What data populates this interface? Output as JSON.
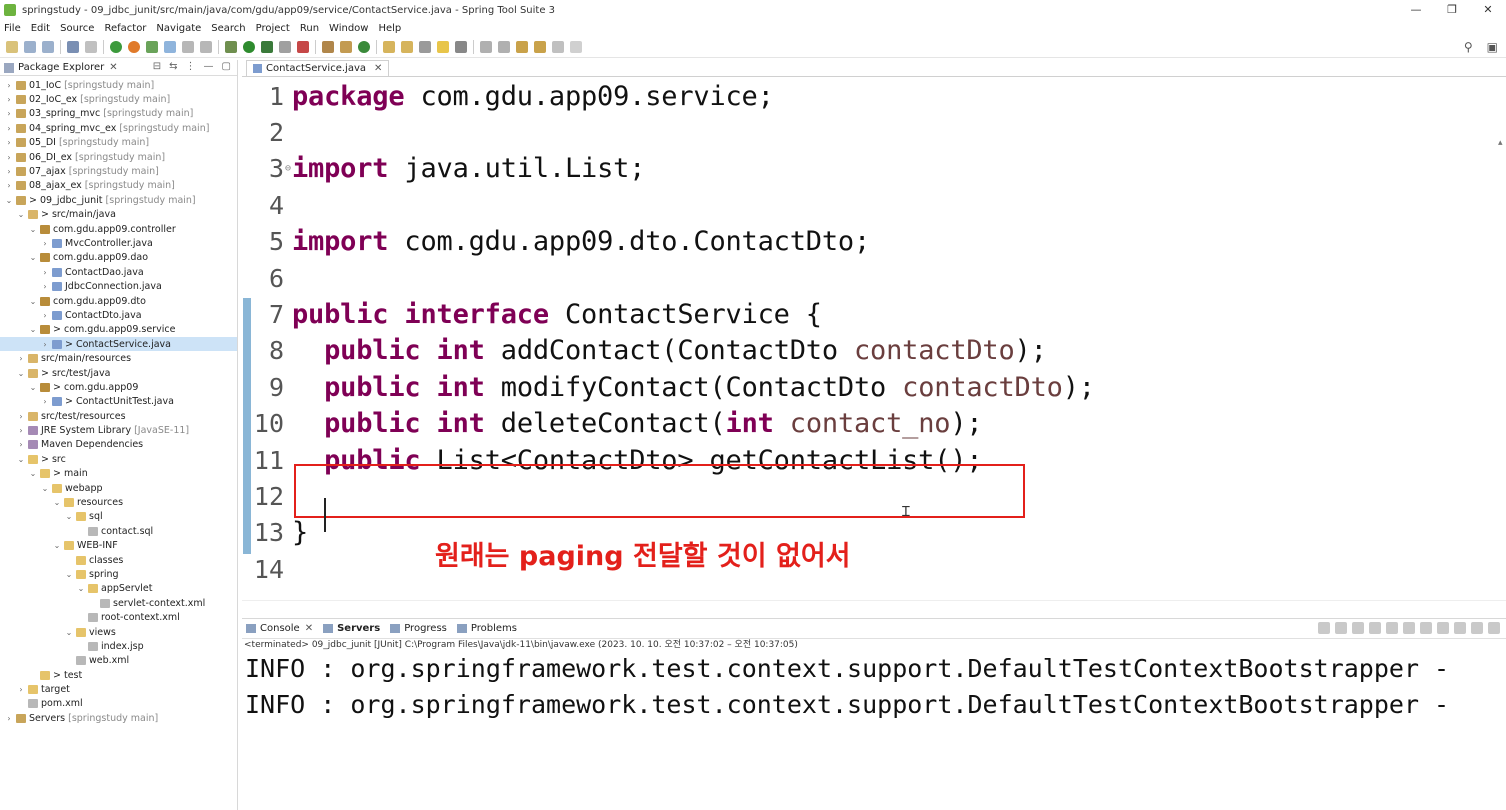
{
  "window": {
    "title": "springstudy - 09_jdbc_junit/src/main/java/com/gdu/app09/service/ContactService.java - Spring Tool Suite 3",
    "minimize": "—",
    "restore": "❐",
    "close": "✕"
  },
  "menu": [
    "File",
    "Edit",
    "Source",
    "Refactor",
    "Navigate",
    "Search",
    "Project",
    "Run",
    "Window",
    "Help"
  ],
  "explorer": {
    "title": "Package Explorer",
    "close": "✕",
    "tree": [
      {
        "indent": 0,
        "tw": "›",
        "icon": "project",
        "label": "01_IoC",
        "sub": "[springstudy main]"
      },
      {
        "indent": 0,
        "tw": "›",
        "icon": "project",
        "label": "02_IoC_ex",
        "sub": "[springstudy main]"
      },
      {
        "indent": 0,
        "tw": "›",
        "icon": "project",
        "label": "03_spring_mvc",
        "sub": "[springstudy main]"
      },
      {
        "indent": 0,
        "tw": "›",
        "icon": "project",
        "label": "04_spring_mvc_ex",
        "sub": "[springstudy main]"
      },
      {
        "indent": 0,
        "tw": "›",
        "icon": "project",
        "label": "05_DI",
        "sub": "[springstudy main]"
      },
      {
        "indent": 0,
        "tw": "›",
        "icon": "project",
        "label": "06_DI_ex",
        "sub": "[springstudy main]"
      },
      {
        "indent": 0,
        "tw": "›",
        "icon": "project",
        "label": "07_ajax",
        "sub": "[springstudy main]"
      },
      {
        "indent": 0,
        "tw": "›",
        "icon": "project",
        "label": "08_ajax_ex",
        "sub": "[springstudy main]"
      },
      {
        "indent": 0,
        "tw": "⌄",
        "icon": "project",
        "label": "> 09_jdbc_junit",
        "sub": "[springstudy main]"
      },
      {
        "indent": 1,
        "tw": "⌄",
        "icon": "src",
        "label": "> src/main/java",
        "sub": ""
      },
      {
        "indent": 2,
        "tw": "⌄",
        "icon": "pkg",
        "label": "com.gdu.app09.controller",
        "sub": ""
      },
      {
        "indent": 3,
        "tw": "›",
        "icon": "java",
        "label": "MvcController.java",
        "sub": ""
      },
      {
        "indent": 2,
        "tw": "⌄",
        "icon": "pkg",
        "label": "com.gdu.app09.dao",
        "sub": ""
      },
      {
        "indent": 3,
        "tw": "›",
        "icon": "java",
        "label": "ContactDao.java",
        "sub": ""
      },
      {
        "indent": 3,
        "tw": "›",
        "icon": "java",
        "label": "JdbcConnection.java",
        "sub": ""
      },
      {
        "indent": 2,
        "tw": "⌄",
        "icon": "pkg",
        "label": "com.gdu.app09.dto",
        "sub": ""
      },
      {
        "indent": 3,
        "tw": "›",
        "icon": "java",
        "label": "ContactDto.java",
        "sub": ""
      },
      {
        "indent": 2,
        "tw": "⌄",
        "icon": "pkg",
        "label": "> com.gdu.app09.service",
        "sub": ""
      },
      {
        "indent": 3,
        "tw": "›",
        "icon": "java",
        "label": "> ContactService.java",
        "sub": "",
        "selected": true
      },
      {
        "indent": 1,
        "tw": "›",
        "icon": "src",
        "label": "src/main/resources",
        "sub": ""
      },
      {
        "indent": 1,
        "tw": "⌄",
        "icon": "src",
        "label": "> src/test/java",
        "sub": ""
      },
      {
        "indent": 2,
        "tw": "⌄",
        "icon": "pkg",
        "label": "> com.gdu.app09",
        "sub": ""
      },
      {
        "indent": 3,
        "tw": "›",
        "icon": "java",
        "label": "> ContactUnitTest.java",
        "sub": ""
      },
      {
        "indent": 1,
        "tw": "›",
        "icon": "src",
        "label": "src/test/resources",
        "sub": ""
      },
      {
        "indent": 1,
        "tw": "›",
        "icon": "lib",
        "label": "JRE System Library",
        "sub": "[JavaSE-11]"
      },
      {
        "indent": 1,
        "tw": "›",
        "icon": "lib",
        "label": "Maven Dependencies",
        "sub": ""
      },
      {
        "indent": 1,
        "tw": "⌄",
        "icon": "folder",
        "label": "> src",
        "sub": ""
      },
      {
        "indent": 2,
        "tw": "⌄",
        "icon": "folder",
        "label": "> main",
        "sub": ""
      },
      {
        "indent": 3,
        "tw": "⌄",
        "icon": "folder",
        "label": "webapp",
        "sub": ""
      },
      {
        "indent": 4,
        "tw": "⌄",
        "icon": "folder",
        "label": "resources",
        "sub": ""
      },
      {
        "indent": 5,
        "tw": "⌄",
        "icon": "folder",
        "label": "sql",
        "sub": ""
      },
      {
        "indent": 6,
        "tw": "",
        "icon": "file",
        "label": "contact.sql",
        "sub": ""
      },
      {
        "indent": 4,
        "tw": "⌄",
        "icon": "folder",
        "label": "WEB-INF",
        "sub": ""
      },
      {
        "indent": 5,
        "tw": "",
        "icon": "folder",
        "label": "classes",
        "sub": ""
      },
      {
        "indent": 5,
        "tw": "⌄",
        "icon": "folder",
        "label": "spring",
        "sub": ""
      },
      {
        "indent": 6,
        "tw": "⌄",
        "icon": "folder",
        "label": "appServlet",
        "sub": ""
      },
      {
        "indent": 7,
        "tw": "",
        "icon": "file",
        "label": "servlet-context.xml",
        "sub": ""
      },
      {
        "indent": 6,
        "tw": "",
        "icon": "file",
        "label": "root-context.xml",
        "sub": ""
      },
      {
        "indent": 5,
        "tw": "⌄",
        "icon": "folder",
        "label": "views",
        "sub": ""
      },
      {
        "indent": 6,
        "tw": "",
        "icon": "file",
        "label": "index.jsp",
        "sub": ""
      },
      {
        "indent": 5,
        "tw": "",
        "icon": "file",
        "label": "web.xml",
        "sub": ""
      },
      {
        "indent": 2,
        "tw": "",
        "icon": "folder",
        "label": "> test",
        "sub": ""
      },
      {
        "indent": 1,
        "tw": "›",
        "icon": "folder",
        "label": "target",
        "sub": ""
      },
      {
        "indent": 1,
        "tw": "",
        "icon": "file",
        "label": "pom.xml",
        "sub": ""
      },
      {
        "indent": 0,
        "tw": "›",
        "icon": "project",
        "label": "Servers",
        "sub": "[springstudy main]"
      }
    ]
  },
  "editor": {
    "tab_label": "ContactService.java",
    "tab_close": "✕",
    "lines": [
      {
        "n": "1",
        "fold": "",
        "segs": [
          {
            "t": "package",
            "c": "kw"
          },
          {
            "t": " com.gdu.app09.service;",
            "c": ""
          }
        ]
      },
      {
        "n": "2",
        "fold": "",
        "segs": []
      },
      {
        "n": "3",
        "fold": "⊖",
        "segs": [
          {
            "t": "import",
            "c": "kw"
          },
          {
            "t": " java.util.List;",
            "c": ""
          }
        ]
      },
      {
        "n": "4",
        "fold": "",
        "segs": []
      },
      {
        "n": "5",
        "fold": "",
        "segs": [
          {
            "t": "import",
            "c": "kw"
          },
          {
            "t": " com.gdu.app09.dto.ContactDto;",
            "c": ""
          }
        ]
      },
      {
        "n": "6",
        "fold": "",
        "segs": []
      },
      {
        "n": "7",
        "fold": "",
        "segs": [
          {
            "t": "public",
            "c": "kw"
          },
          {
            "t": " ",
            "c": ""
          },
          {
            "t": "interface",
            "c": "kw"
          },
          {
            "t": " ContactService {",
            "c": ""
          }
        ]
      },
      {
        "n": "8",
        "fold": "",
        "segs": [
          {
            "t": "  ",
            "c": ""
          },
          {
            "t": "public",
            "c": "kw"
          },
          {
            "t": " ",
            "c": ""
          },
          {
            "t": "int",
            "c": "kw"
          },
          {
            "t": " addContact(ContactDto ",
            "c": ""
          },
          {
            "t": "contactDto",
            "c": "param"
          },
          {
            "t": ");",
            "c": ""
          }
        ]
      },
      {
        "n": "9",
        "fold": "",
        "segs": [
          {
            "t": "  ",
            "c": ""
          },
          {
            "t": "public",
            "c": "kw"
          },
          {
            "t": " ",
            "c": ""
          },
          {
            "t": "int",
            "c": "kw"
          },
          {
            "t": " modifyContact(ContactDto ",
            "c": ""
          },
          {
            "t": "contactDto",
            "c": "param"
          },
          {
            "t": ");",
            "c": ""
          }
        ]
      },
      {
        "n": "10",
        "fold": "",
        "segs": [
          {
            "t": "  ",
            "c": ""
          },
          {
            "t": "public",
            "c": "kw"
          },
          {
            "t": " ",
            "c": ""
          },
          {
            "t": "int",
            "c": "kw"
          },
          {
            "t": " deleteContact(",
            "c": ""
          },
          {
            "t": "int",
            "c": "kw"
          },
          {
            "t": " ",
            "c": ""
          },
          {
            "t": "contact_no",
            "c": "param"
          },
          {
            "t": ");",
            "c": ""
          }
        ]
      },
      {
        "n": "11",
        "fold": "",
        "segs": [
          {
            "t": "  ",
            "c": ""
          },
          {
            "t": "public",
            "c": "kw"
          },
          {
            "t": " List<ContactDto> getContactList();",
            "c": ""
          }
        ]
      },
      {
        "n": "12",
        "fold": "",
        "segs": []
      },
      {
        "n": "13",
        "fold": "",
        "segs": [
          {
            "t": "}",
            "c": ""
          }
        ]
      },
      {
        "n": "14",
        "fold": "",
        "segs": []
      }
    ],
    "annotation": "원래는 paging 전달할 것이 없어서"
  },
  "bottom": {
    "tabs": [
      {
        "label": "Console",
        "active": false,
        "close": "✕"
      },
      {
        "label": "Servers",
        "active": true,
        "close": ""
      },
      {
        "label": "Progress",
        "active": false,
        "close": ""
      },
      {
        "label": "Problems",
        "active": false,
        "close": ""
      }
    ],
    "console_header": "<terminated> 09_jdbc_junit [JUnit] C:\\Program Files\\Java\\jdk-11\\bin\\javaw.exe  (2023. 10. 10. 오전 10:37:02 – 오전 10:37:05)",
    "console_lines": [
      "INFO : org.springframework.test.context.support.DefaultTestContextBootstrapper -",
      "INFO : org.springframework.test.context.support.DefaultTestContextBootstrapper -"
    ]
  },
  "colors": {
    "keyword": "#7f0055",
    "param": "#6a3e3e",
    "annotation": "#e3201b",
    "selection": "#cde3f7"
  }
}
